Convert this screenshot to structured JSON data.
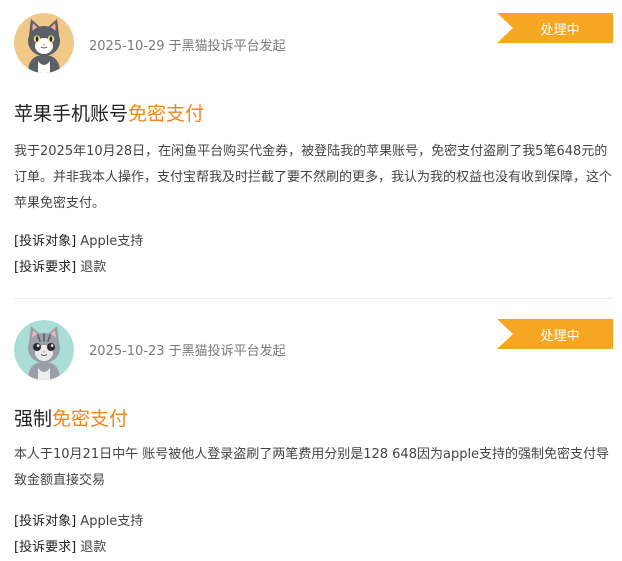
{
  "complaints": [
    {
      "date_source": "2025-10-29 于黑猫投诉平台发起",
      "status": "处理中",
      "title_plain": "苹果手机账号",
      "title_highlight": "免密支付",
      "description": "我于2025年10月28日，在闲鱼平台购买代金券，被登陆我的苹果账号，免密支付盗刷了我5笔648元的订单。并非我本人操作，支付宝帮我及时拦截了要不然刷的更多，我认为我的权益也没有收到保障，这个苹果免密支付。",
      "target_label": "[投诉对象]",
      "target_value": "Apple支持",
      "demand_label": "[投诉要求]",
      "demand_value": "退款",
      "avatar_icon": "cat-avatar-orange-icon"
    },
    {
      "date_source": "2025-10-23 于黑猫投诉平台发起",
      "status": "处理中",
      "title_plain": "强制",
      "title_highlight": "免密支付",
      "description": "本人于10月21日中午 账号被他人登录盗刷了两笔费用分别是128 648因为apple支持的强制免密支付导致金额直接交易",
      "target_label": "[投诉对象]",
      "target_value": "Apple支持",
      "demand_label": "[投诉要求]",
      "demand_value": "退款",
      "avatar_icon": "cat-avatar-teal-icon"
    }
  ],
  "colors": {
    "badge": "#f5a623",
    "highlight": "#f08519",
    "meta": "#7a7a7a"
  }
}
